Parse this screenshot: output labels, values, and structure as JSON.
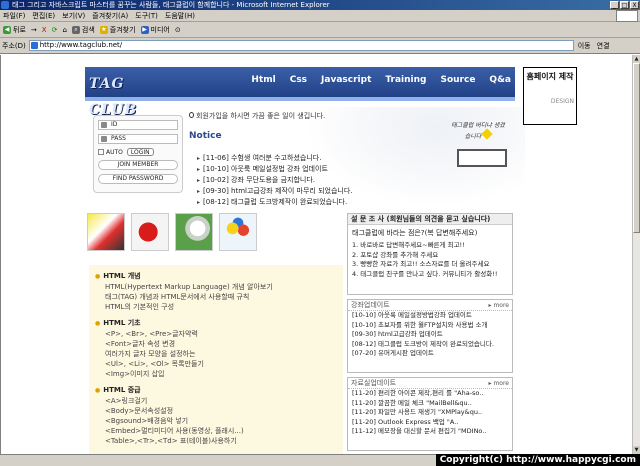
{
  "window": {
    "title": "태그 그리고 자바스크립트 마스터를 꿈꾸는 사람들, 태그클럽이 함께합니다 - Microsoft Internet Explorer",
    "buttons": [
      "_",
      "□",
      "X"
    ]
  },
  "menu": [
    "파일(F)",
    "편집(E)",
    "보기(V)",
    "즐겨찾기(A)",
    "도구(T)",
    "도움말(H)"
  ],
  "toolbar": {
    "back": "뒤로",
    "forward": "→",
    "stop": "X",
    "refresh": "⟳",
    "home": "⌂",
    "search": "검색",
    "favorites": "즐겨찾기",
    "media": "미디어",
    "history": "⊙"
  },
  "address": {
    "label": "주소(D)",
    "url": "http://www.tagclub.net/",
    "go": "이동",
    "links": "연결"
  },
  "site": {
    "logo": "TAG CLUB",
    "nav": [
      "Html",
      "Css",
      "Javascript",
      "Training",
      "Source",
      "Q&a"
    ],
    "ad_title": "홈페이지 제작",
    "ad_sub": "DESIGN"
  },
  "login": {
    "id": "ID",
    "pw": "PASS",
    "auto": "AUTO",
    "login": "LOGIN",
    "join": "JOIN MEMBER",
    "find": "FIND PASSWORD"
  },
  "notice": {
    "welcome": "회원가입을 하시면 가끔 좋은 일이 생깁니다.",
    "title": "Notice",
    "items": [
      "[11-06] 수험생 여러분 수고하셨습니다.",
      "[10-10] 아웃룩 메일설정법 강좌 업데이트",
      "[10-02] 강좌 무단도용을 금지합니다.",
      "[09-30] html고급강좌 제작이 마무리 되었습니다.",
      "[08-12] 태그클럽 도크방제작이 완료되었습니다."
    ],
    "speech": "태그클럽 버디냐 생겼습니다"
  },
  "left_sections": [
    {
      "title": "HTML 개념",
      "items": [
        "HTML(Hypertext Markup Language) 개념 알아보기",
        "태그(TAG) 개념과 HTML문서에서 사용할때 규칙",
        "HTML의 기본적인 구성"
      ]
    },
    {
      "title": "HTML 기초",
      "items": [
        "<P>, <Br>, <Pre>글자약력",
        "<Font>글자 속성 변경",
        "여러가지 글자 모양을 설정하는",
        "<Ul>, <Li>, <Ol> 목록만들기",
        "<Img>이미지 삽입"
      ]
    },
    {
      "title": "HTML 중급",
      "items": [
        "<A>링크걸기",
        "<Body>문서속성설정",
        "<Bgsound>배경음악 넣기",
        "<Embed>멀티미디어 사용(동영상, 플래시...)",
        "<Table>,<Tr>,<Td> 표(테이블)사용하기"
      ]
    }
  ],
  "poll": {
    "header": "설 문 조 사 (회원님들의 의견을 묻고 싶습니다)",
    "question": "태그클럽에 바라는 점은?(복 답변해주세요)",
    "options": [
      "1. 바로바로 답변해주세요~빠른게 최고!!",
      "2. 포토샵 강좌를 추가해 주세요",
      "3. 빵빵한 자료가 최고!! 소스자료를 더 올려주세요",
      "4. 태그클럽 친구를 만나고 싶다. 커뮤니티가 활성화!!"
    ]
  },
  "updates": {
    "header": "강좌업데이트",
    "more": "more",
    "items": [
      "[10-10] 아웃룩 메일설정방법강좌 업데이트",
      "[10-10] 초보자를 위한 월FTP설치와 사용법 소개",
      "[09-30] html고급강좌 업데이트",
      "[08-12] 태그클럽 도크방이 제작이 완료되었습니다.",
      "[07-20] 유머게시판 업데이트"
    ]
  },
  "resources": {
    "header": "자료실업데이트",
    "more": "more",
    "items": [
      "[11-20] 편리한 아이콘 제작,편리 를 \"Aha-so..",
      "[11-20] 깔끔한 메일 체크 \"MailBell&qu..",
      "[11-20] 파일만 사용드 재생기 \"XMPlay&qu..",
      "[11-20] Outlook Express 백업 \"A..",
      "[11-12] 메모장을 대신할 문서 편집기 \"MDINo.."
    ]
  },
  "statusbar": "",
  "copyright": "Copyright(c) http://www.happycgi.com"
}
